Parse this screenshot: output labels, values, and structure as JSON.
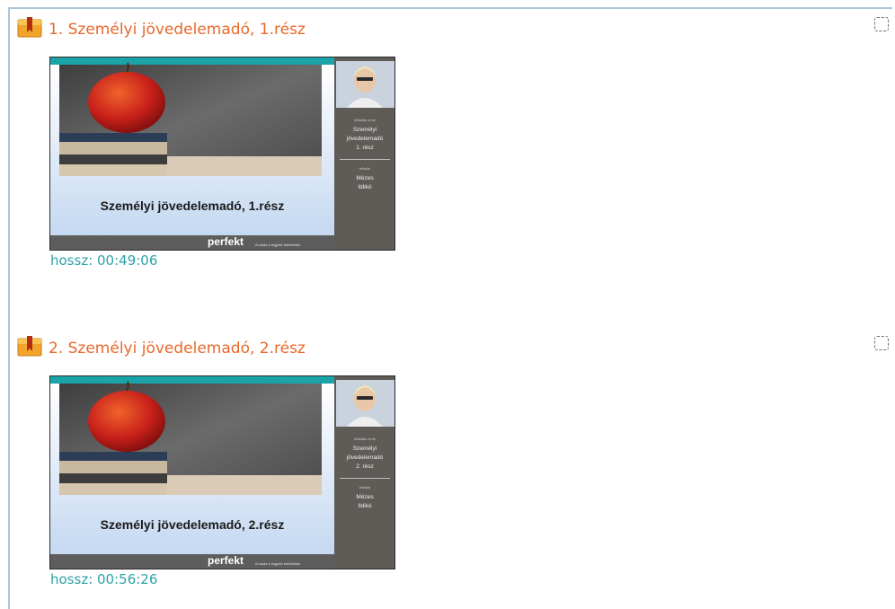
{
  "activities": [
    {
      "icon": "book-module-icon",
      "title": "1. Személyi jövedelemadó, 1.rész",
      "duration": "hossz: 00:49:06",
      "slide": {
        "heading": "Személyi jövedelemadó, 1.rész",
        "brand": "perfekt",
        "tagline": "A tudás a legjobb befektetés",
        "side_topic_label": "előadás címe",
        "side_topic_lines": [
          "Személyi",
          "jövedelemadó",
          "1. rész"
        ],
        "side_presenter_label": "előadó",
        "side_presenter_lines": [
          "Mézes",
          "Ildikó"
        ]
      }
    },
    {
      "icon": "book-module-icon",
      "title": "2. Személyi jövedelemadó, 2.rész",
      "duration": "hossz: 00:56:26",
      "slide": {
        "heading": "Személyi jövedelemadó, 2.rész",
        "brand": "perfekt",
        "tagline": "A tudás a legjobb befektetés",
        "side_topic_label": "előadás címe",
        "side_topic_lines": [
          "Személyi",
          "jövedelemadó",
          "2. rész"
        ],
        "side_presenter_label": "előadó",
        "side_presenter_lines": [
          "Mézes",
          "Ildikó"
        ]
      }
    }
  ]
}
